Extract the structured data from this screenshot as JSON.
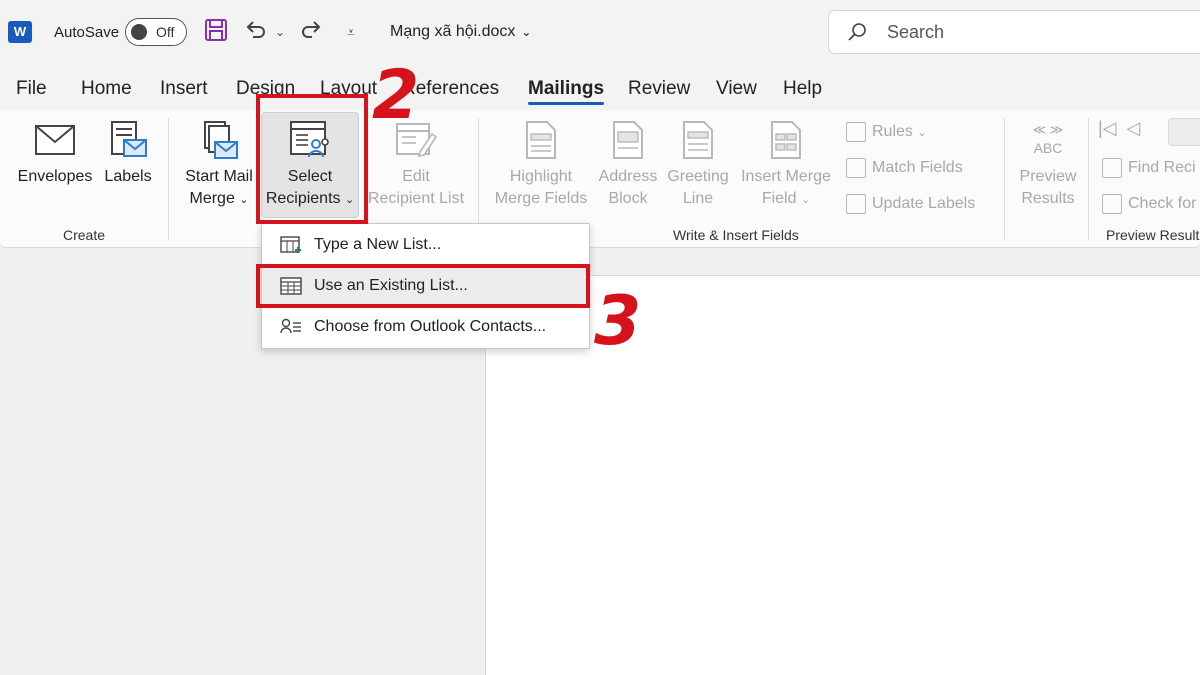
{
  "titlebar": {
    "app_logo": "W",
    "autosave_label": "AutoSave",
    "autosave_state": "Off",
    "doc_title": "Mạng xã hội.docx",
    "search_placeholder": "Search"
  },
  "menu_tabs": [
    {
      "label": "File"
    },
    {
      "label": "Home"
    },
    {
      "label": "Insert"
    },
    {
      "label": "Design"
    },
    {
      "label": "Layout"
    },
    {
      "label": "References"
    },
    {
      "label": "Mailings",
      "active": true
    },
    {
      "label": "Review"
    },
    {
      "label": "View"
    },
    {
      "label": "Help"
    }
  ],
  "ribbon": {
    "create": {
      "envelopes": "Envelopes",
      "labels": "Labels",
      "group_label": "Create"
    },
    "start_mail_merge": {
      "start_mail_merge_l1": "Start Mail",
      "start_mail_merge_l2": "Merge",
      "select_recipients_l1": "Select",
      "select_recipients_l2": "Recipients",
      "edit_recipient_l1": "Edit",
      "edit_recipient_l2": "Recipient List"
    },
    "write_insert": {
      "highlight_l1": "Highlight",
      "highlight_l2": "Merge Fields",
      "address_l1": "Address",
      "address_l2": "Block",
      "greeting_l1": "Greeting",
      "greeting_l2": "Line",
      "insert_merge_l1": "Insert Merge",
      "insert_merge_l2": "Field",
      "rules": "Rules",
      "match_fields": "Match Fields",
      "update_labels": "Update Labels",
      "group_label": "Write & Insert Fields"
    },
    "preview": {
      "abc": "ABC",
      "preview_l1": "Preview",
      "preview_l2": "Results",
      "find_recipient": "Find Reci",
      "check_for": "Check for",
      "group_label": "Preview Result"
    }
  },
  "dropdown": {
    "items": [
      {
        "label": "Type a New List..."
      },
      {
        "label": "Use an Existing List..."
      },
      {
        "label": "Choose from Outlook Contacts..."
      }
    ]
  },
  "annotations": {
    "step2": "2",
    "step3": "3"
  },
  "colors": {
    "accent": "#185abd",
    "annotation_red": "#d6121b"
  }
}
